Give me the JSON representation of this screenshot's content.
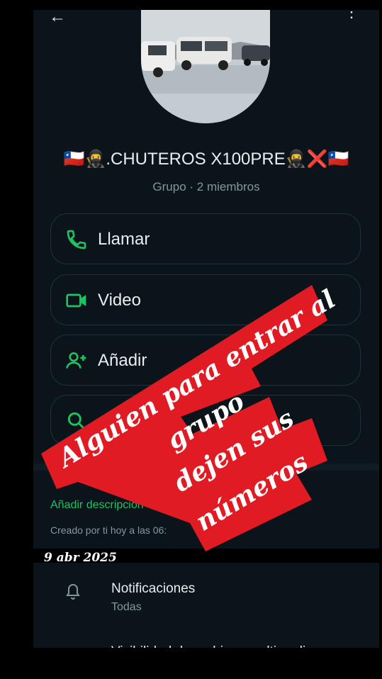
{
  "header": {
    "back_icon": "arrow-left-icon",
    "menu_icon": "more-vert-icon"
  },
  "group": {
    "name": "🇨🇱🥷.CHUTEROS X100PRE🥷❌🇨🇱",
    "subtitle": "Grupo · 2 miembros"
  },
  "actions": [
    {
      "label": "Llamar",
      "icon": "phone-icon"
    },
    {
      "label": "Video",
      "icon": "video-icon"
    },
    {
      "label": "Añadir",
      "icon": "add-person-icon"
    },
    {
      "label": "",
      "icon": "search-icon"
    }
  ],
  "info": {
    "add_description": "Añadir descripción",
    "created": "Creado por ti hoy a las 06:"
  },
  "overlay_date": "9 abr 2025",
  "notifications": {
    "title": "Notificaciones",
    "value": "Todas"
  },
  "next_item_cut": "Visibilidad de archivos multimedia",
  "sticker": {
    "lines": [
      "Alguien para entrar al",
      "grupo",
      "dejen sus",
      "números"
    ],
    "color": "#e01b24"
  },
  "colors": {
    "accent": "#21c063",
    "background": "#0b141a"
  }
}
